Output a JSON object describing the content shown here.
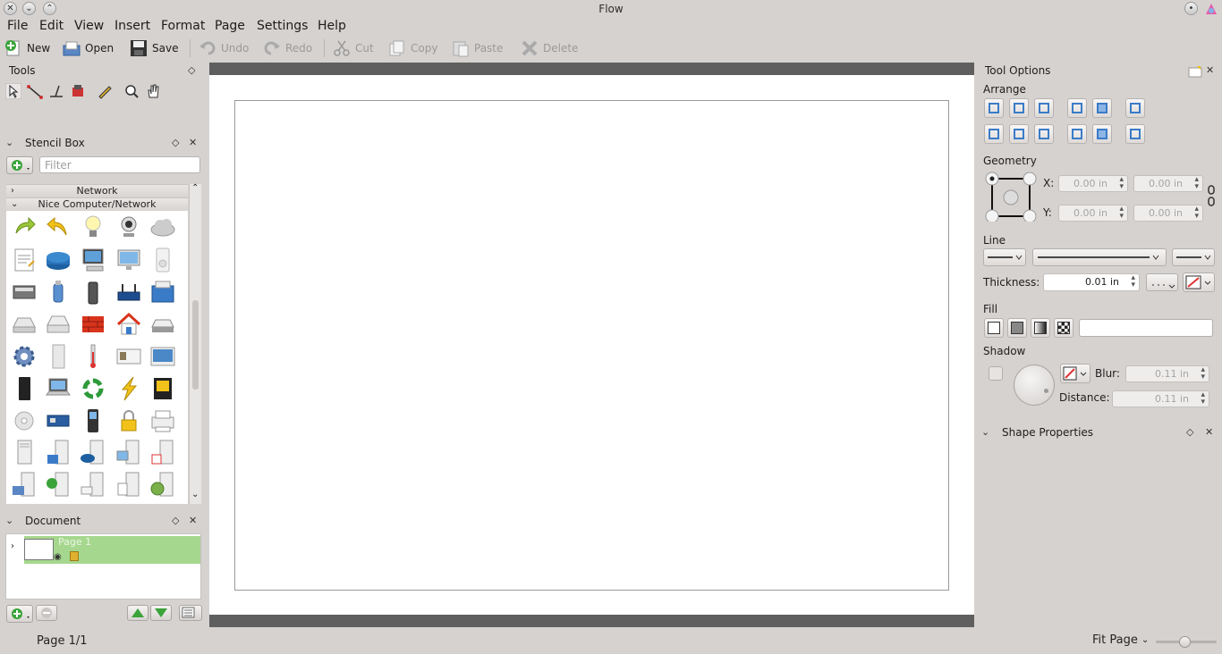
{
  "window": {
    "title": "Flow"
  },
  "menu": [
    "File",
    "Edit",
    "View",
    "Insert",
    "Format",
    "Page",
    "Settings",
    "Help"
  ],
  "toolbar": {
    "new": "New",
    "open": "Open",
    "save": "Save",
    "undo": "Undo",
    "redo": "Redo",
    "cut": "Cut",
    "copy": "Copy",
    "paste": "Paste",
    "delete": "Delete"
  },
  "tools_docker": {
    "title": "Tools"
  },
  "stencil_box": {
    "title": "Stencil Box",
    "filter_placeholder": "Filter",
    "categories": [
      "Network",
      "Nice Computer/Network"
    ]
  },
  "document_docker": {
    "title": "Document",
    "page_name": "Page 1"
  },
  "tool_options": {
    "title": "Tool Options",
    "arrange": "Arrange",
    "geometry": "Geometry",
    "x_label": "X:",
    "y_label": "Y:",
    "x_value": "0.00 in",
    "y_value": "0.00 in",
    "width_value": "0.00 in",
    "height_value": "0.00 in",
    "line": "Line",
    "thickness_label": "Thickness:",
    "thickness_value": "0.01 in",
    "fill": "Fill",
    "shadow": "Shadow",
    "blur_label": "Blur:",
    "blur_value": "0.11 in",
    "distance_label": "Distance:",
    "distance_value": "0.11 in"
  },
  "shape_properties": {
    "title": "Shape Properties"
  },
  "status": {
    "page": "Page 1/1",
    "zoom": "Fit Page"
  },
  "colors": {
    "accent": "#3a7bc8",
    "page_selected": "#a6d78f",
    "canvas_border": "#5f5f5f"
  }
}
